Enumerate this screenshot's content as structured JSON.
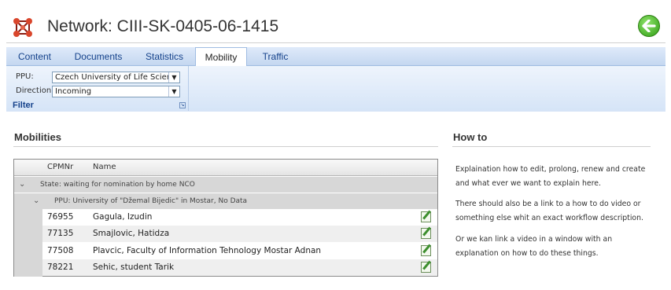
{
  "header": {
    "title": "Network: CIII-SK-0405-06-1415"
  },
  "tabs": [
    {
      "label": "Content",
      "active": false
    },
    {
      "label": "Documents",
      "active": false
    },
    {
      "label": "Statistics",
      "active": false
    },
    {
      "label": "Mobility",
      "active": true
    },
    {
      "label": "Traffic",
      "active": false
    }
  ],
  "filter": {
    "caption": "Filter",
    "ppu_label": "PPU:",
    "ppu_value": "Czech University of Life Science:",
    "direction_label": "Direction:",
    "direction_value": "Incoming"
  },
  "mobilities": {
    "title": "Mobilities",
    "columns": [
      "CPMNr",
      "Name"
    ],
    "group_state": "State: waiting for nomination by home NCO",
    "group_ppu": "PPU: University of \"Džemal Bijedic\" in Mostar, No Data",
    "rows": [
      {
        "cpmnr": "76955",
        "name": "Gagula, Izudin"
      },
      {
        "cpmnr": "77135",
        "name": "Smajlovic, Hatidza"
      },
      {
        "cpmnr": "77508",
        "name": "Plavcic, Faculty of Information Tehnology Mostar Adnan"
      },
      {
        "cpmnr": "78221",
        "name": "Sehic, student Tarik"
      }
    ]
  },
  "howto": {
    "title": "How to",
    "paragraphs": [
      "Explaination how to edit, prolong, renew and create and what ever we want to explain here.",
      "There should also be a link to a how to do video or something else whit an exact workflow description.",
      "Or we kan link a video in a window with an explanation on how to do these things."
    ]
  },
  "colors": {
    "tab_text": "#15428b",
    "ribbon_bg": "#d5e4f7",
    "back_button": "#2f9d14",
    "group_row_bg": "#d7d7d7"
  }
}
